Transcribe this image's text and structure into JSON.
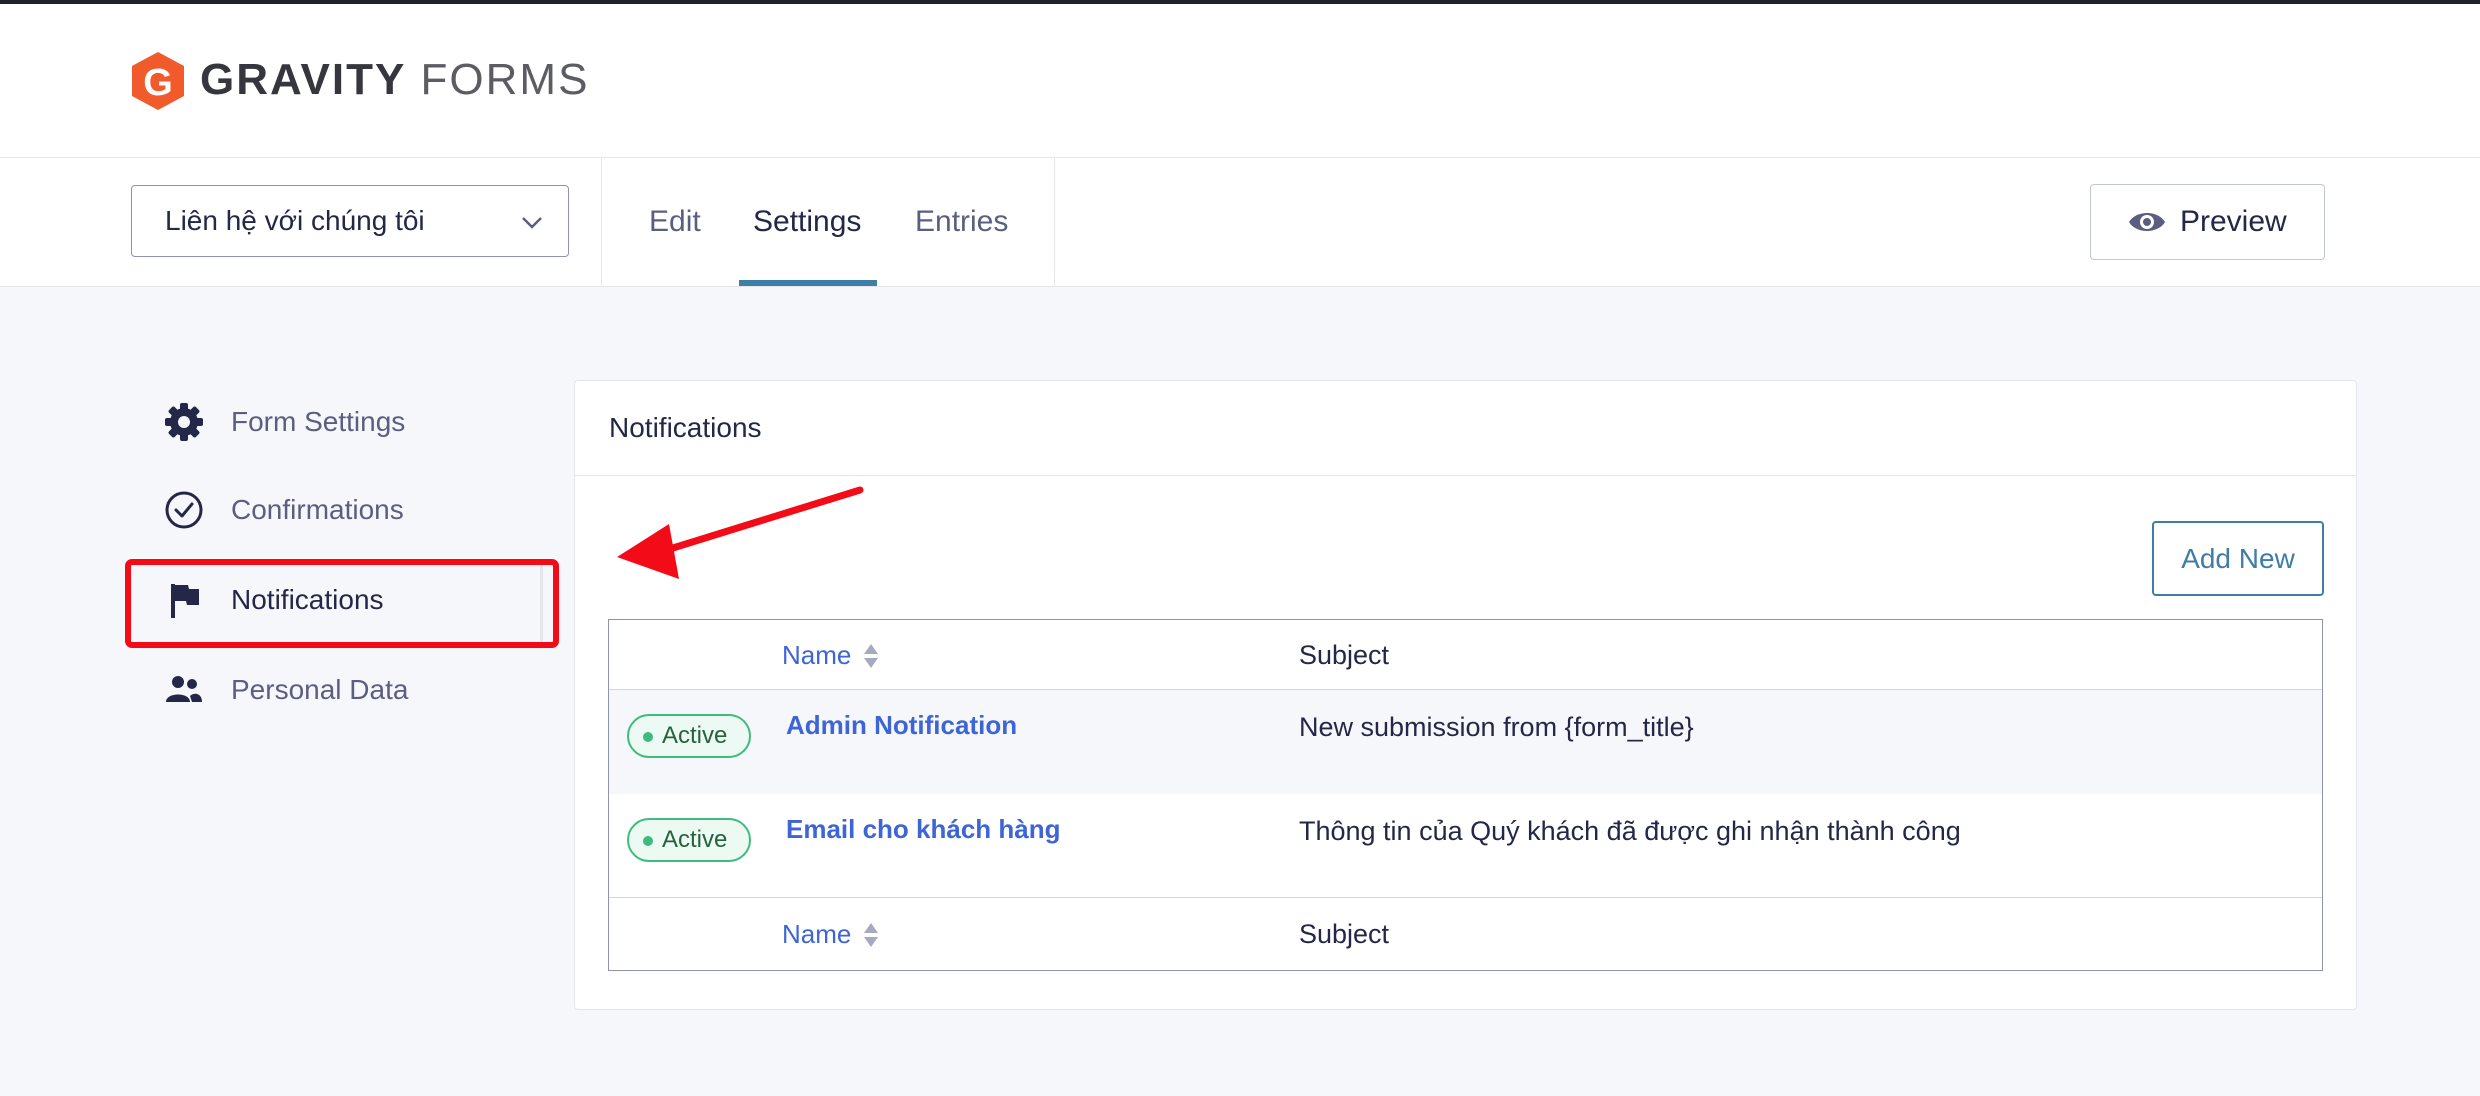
{
  "brand": {
    "name_bold": "GRAVITY",
    "name_light": "FORMS",
    "logo_letter": "G",
    "color": "#f15a2b"
  },
  "form_selector": {
    "value": "Liên hệ với chúng tôi"
  },
  "tabs": [
    {
      "label": "Edit",
      "active": false
    },
    {
      "label": "Settings",
      "active": true
    },
    {
      "label": "Entries",
      "active": false
    }
  ],
  "preview": {
    "label": "Preview",
    "icon": "eye-icon"
  },
  "sidebar": {
    "items": [
      {
        "label": "Form Settings",
        "icon": "gear-icon"
      },
      {
        "label": "Confirmations",
        "icon": "check-circle-icon"
      },
      {
        "label": "Notifications",
        "icon": "flag-icon",
        "active": true
      },
      {
        "label": "Personal Data",
        "icon": "users-icon"
      }
    ]
  },
  "panel": {
    "title": "Notifications",
    "add_new_label": "Add New",
    "columns": {
      "name": "Name",
      "subject": "Subject"
    },
    "rows": [
      {
        "status": "Active",
        "name": "Admin Notification",
        "subject": "New submission from {form_title}"
      },
      {
        "status": "Active",
        "name": "Email cho khách hàng",
        "subject": "Thông tin của Quý khách đã được ghi nhận thành công"
      }
    ]
  },
  "colors": {
    "accent": "#3e7da6",
    "link": "#3e65d5",
    "active_green": "#3ebc80",
    "annotation_red": "#f30b18"
  }
}
